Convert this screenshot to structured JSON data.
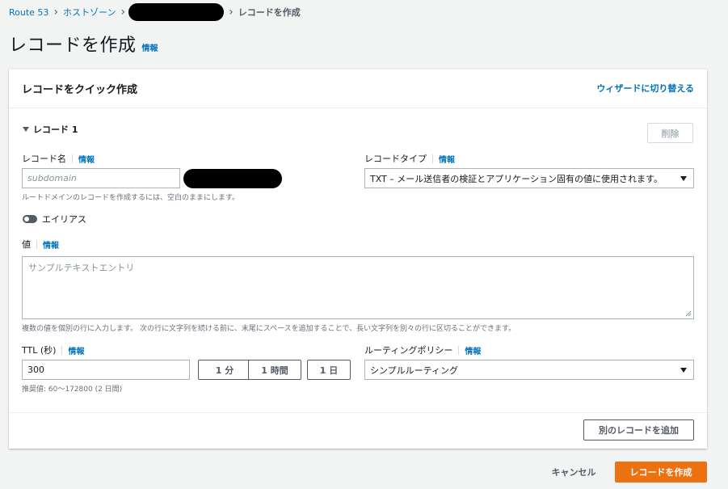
{
  "breadcrumb": {
    "items": [
      "Route 53",
      "ホストゾーン"
    ],
    "current": "レコードを作成"
  },
  "page": {
    "title": "レコードを作成",
    "info": "情報"
  },
  "panel": {
    "title": "レコードをクイック作成",
    "wizard_link": "ウィザードに切り替える"
  },
  "record": {
    "heading": "レコード 1",
    "delete_label": "削除",
    "name_label": "レコード名",
    "name_info": "情報",
    "name_placeholder": "subdomain",
    "name_hint": "ルートドメインのレコードを作成するには、空白のままにします。",
    "type_label": "レコードタイプ",
    "type_info": "情報",
    "type_value": "TXT – メール送信者の検証とアプリケーション固有の値に使用されます。",
    "alias_label": "エイリアス",
    "value_label": "値",
    "value_info": "情報",
    "value_placeholder": "サンプルテキストエントリ",
    "value_hint": "複数の値を個別の行に入力します。 次の行に文字列を続ける前に、末尾にスペースを追加することで、長い文字列を別々の行に区切ることができます。",
    "ttl_label": "TTL (秒)",
    "ttl_info": "情報",
    "ttl_value": "300",
    "ttl_hint": "推奨値: 60～172800 (2 日間)",
    "ttl_buttons": [
      "1 分",
      "1 時間",
      "1 日"
    ],
    "routing_label": "ルーティングポリシー",
    "routing_info": "情報",
    "routing_value": "シンプルルーティング"
  },
  "actions": {
    "add_record": "別のレコードを追加",
    "cancel": "キャンセル",
    "create": "レコードを作成"
  },
  "colors": {
    "link": "#0073bb",
    "primary": "#ec7211",
    "background": "#f2f3f3"
  }
}
